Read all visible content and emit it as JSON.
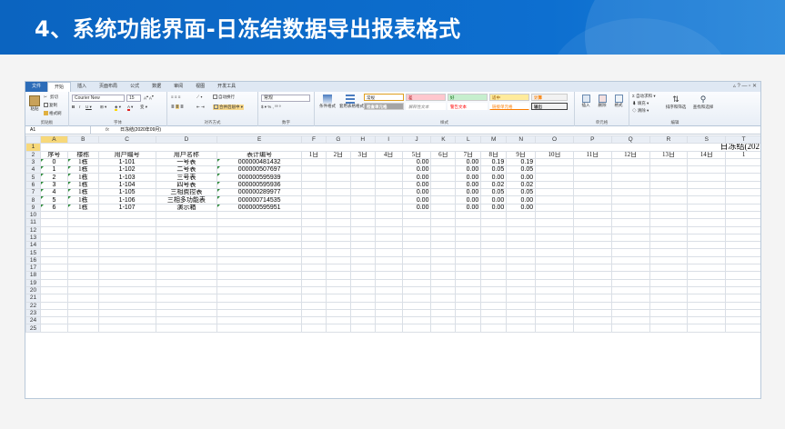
{
  "slide": {
    "title": "4、系统功能界面-日冻结数据导出报表格式"
  },
  "ribbon": {
    "tabs": [
      "文件",
      "开始",
      "插入",
      "页面布局",
      "公式",
      "数据",
      "审阅",
      "视图",
      "开发工具"
    ],
    "clipboard": {
      "cut": "剪切",
      "copy": "复制",
      "paste": "粘贴",
      "format_painter": "格式刷",
      "label": "剪贴板"
    },
    "font": {
      "name": "Courier New",
      "size": "15",
      "label": "字体"
    },
    "alignment": {
      "wrap": "自动换行",
      "merge": "合并后居中",
      "label": "对齐方式"
    },
    "number": {
      "format": "常规",
      "label": "数字"
    },
    "styles": {
      "conditional": "条件格式",
      "table_format": "套用表格格式",
      "cells": [
        "常规",
        "差",
        "好",
        "适中",
        "计算",
        "检查单元格",
        "解释性文本",
        "警告文本",
        "链接单元格",
        "输出"
      ],
      "label": "样式"
    },
    "cells_group": {
      "insert": "插入",
      "delete": "删除",
      "format": "格式",
      "label": "单元格"
    },
    "editing": {
      "autosum": "自动求和",
      "fill": "填充",
      "clear": "清除",
      "sort": "排序和筛选",
      "find": "查找和选择",
      "label": "编辑"
    }
  },
  "formula_bar": {
    "name_box": "A1",
    "fx": "fx",
    "content": "日冻结(2020年09月)"
  },
  "columns": [
    "A",
    "B",
    "C",
    "D",
    "E",
    "F",
    "G",
    "H",
    "I",
    "J",
    "K",
    "L",
    "M",
    "N",
    "O",
    "P",
    "Q",
    "R",
    "S",
    "T"
  ],
  "sheet_title": "日冻结(202",
  "header_row": [
    "序号",
    "楼栋",
    "用户编号",
    "用户名称",
    "表计编号",
    "1日",
    "2日",
    "3日",
    "4日",
    "5日",
    "6日",
    "7日",
    "8日",
    "9日",
    "10日",
    "11日",
    "12日",
    "13日",
    "14日",
    "1"
  ],
  "rows": [
    [
      "0",
      "1栋",
      "1-101",
      "一号表",
      "000000481432",
      "",
      "",
      "",
      "",
      "0.00",
      "",
      "0.00",
      "0.19",
      "0.19"
    ],
    [
      "1",
      "1栋",
      "1-102",
      "二号表",
      "000000507697",
      "",
      "",
      "",
      "",
      "0.00",
      "",
      "0.00",
      "0.05",
      "0.05"
    ],
    [
      "2",
      "1栋",
      "1-103",
      "三号表",
      "000000595939",
      "",
      "",
      "",
      "",
      "0.00",
      "",
      "0.00",
      "0.00",
      "0.00"
    ],
    [
      "3",
      "1栋",
      "1-104",
      "四号表",
      "000000595936",
      "",
      "",
      "",
      "",
      "0.00",
      "",
      "0.00",
      "0.02",
      "0.02"
    ],
    [
      "4",
      "1栋",
      "1-105",
      "三相费控表",
      "000000289977",
      "",
      "",
      "",
      "",
      "0.00",
      "",
      "0.00",
      "0.05",
      "0.05"
    ],
    [
      "5",
      "1栋",
      "1-106",
      "三相多功能表",
      "000000714535",
      "",
      "",
      "",
      "",
      "0.00",
      "",
      "0.00",
      "0.00",
      "0.00"
    ],
    [
      "6",
      "1栋",
      "1-107",
      "演示箱",
      "000000595951",
      "",
      "",
      "",
      "",
      "0.00",
      "",
      "0.00",
      "0.00",
      "0.00"
    ]
  ],
  "row_numbers": [
    "1",
    "2",
    "3",
    "4",
    "5",
    "6",
    "7",
    "8",
    "9",
    "10",
    "11",
    "12",
    "13",
    "14",
    "15",
    "16",
    "17",
    "18",
    "19",
    "20",
    "21",
    "22",
    "23",
    "24",
    "25"
  ]
}
